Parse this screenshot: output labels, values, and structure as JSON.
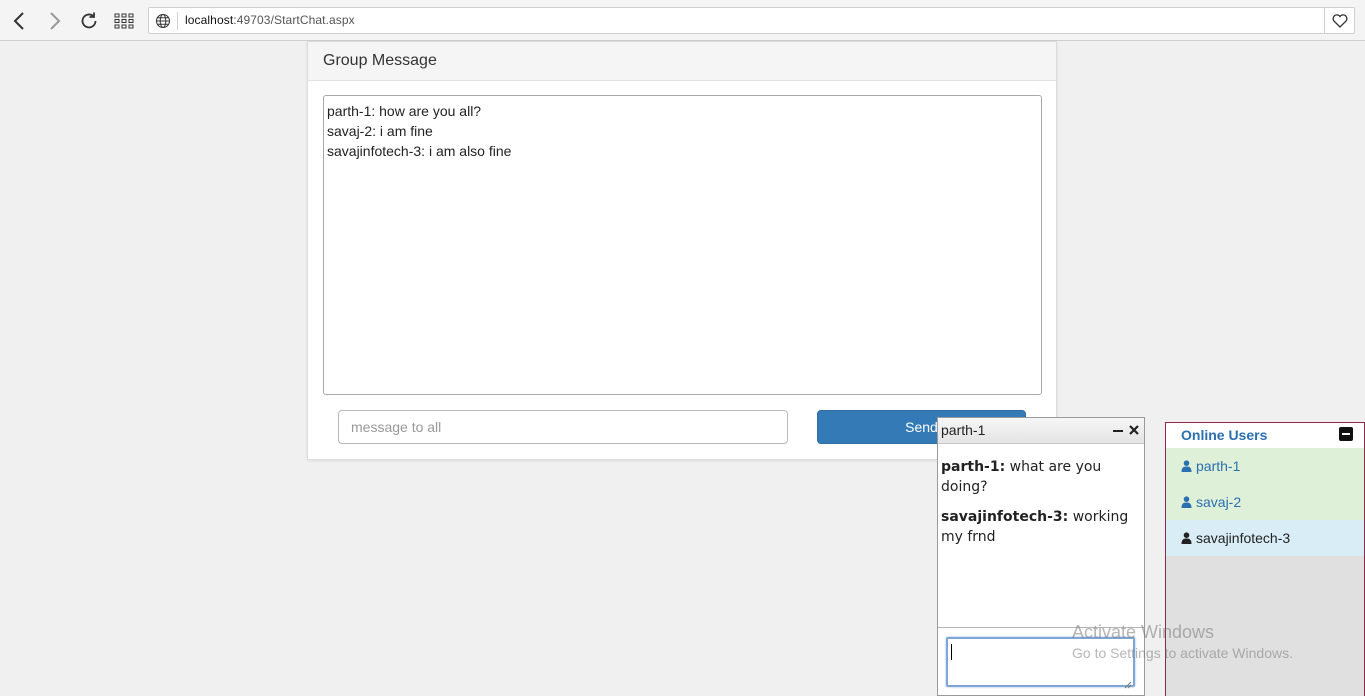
{
  "browser": {
    "url_host": "localhost",
    "url_rest": ":49703/StartChat.aspx"
  },
  "group_panel": {
    "title": "Group Message",
    "messages": [
      "parth-1: how are you all?",
      "savaj-2: i am fine",
      "savajinfotech-3: i am also fine"
    ],
    "input_placeholder": "message to all",
    "send_label": "Send"
  },
  "private_chat": {
    "title": "parth-1",
    "messages": [
      {
        "sender": "parth-1:",
        "text": "what are you doing?"
      },
      {
        "sender": "savajinfotech-3:",
        "text": "working my frnd"
      }
    ]
  },
  "online_users": {
    "title": "Online Users",
    "users": [
      {
        "name": "parth-1"
      },
      {
        "name": "savaj-2"
      },
      {
        "name": "savajinfotech-3"
      }
    ]
  },
  "watermark": {
    "line1": "Activate Windows",
    "line2": "Go to Settings to activate Windows."
  },
  "colors": {
    "primary": "#337ab7",
    "user_green_bg": "#dff0d8",
    "user_blue_bg": "#d9edf7",
    "users_border": "#8b2a4a"
  }
}
